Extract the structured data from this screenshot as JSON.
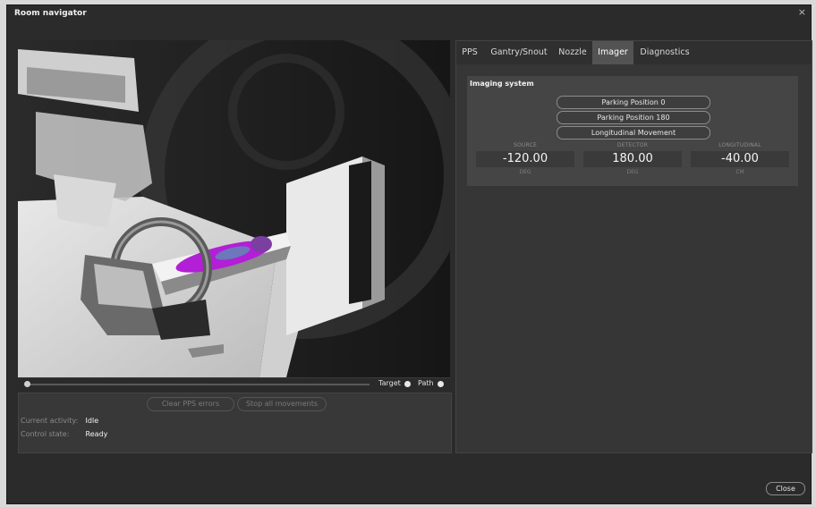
{
  "window": {
    "title": "Room navigator",
    "close_glyph": "×"
  },
  "viewport": {
    "scene": "treatment-room-3d-view",
    "toggles": [
      {
        "label": "Target"
      },
      {
        "label": "Path"
      }
    ]
  },
  "controls": {
    "clear_pps_errors": "Clear PPS errors",
    "stop_all_movements": "Stop all movements",
    "current_activity_label": "Current activity:",
    "current_activity_value": "Idle",
    "control_state_label": "Control state:",
    "control_state_value": "Ready"
  },
  "tabs": [
    {
      "label": "PPS",
      "active": false
    },
    {
      "label": "Gantry/Snout",
      "active": false
    },
    {
      "label": "Nozzle",
      "active": false
    },
    {
      "label": "Imager",
      "active": true
    },
    {
      "label": "Diagnostics",
      "active": false
    }
  ],
  "imaging": {
    "title": "Imaging system",
    "buttons": [
      "Parking Position 0",
      "Parking Position 180",
      "Longitudinal Movement"
    ],
    "values": [
      {
        "header": "SOURCE",
        "value": "-120.00",
        "unit": "DEG"
      },
      {
        "header": "DETECTOR",
        "value": "180.00",
        "unit": "DEG"
      },
      {
        "header": "LONGITUDINAL",
        "value": "-40.00",
        "unit": "CM"
      }
    ]
  },
  "footer": {
    "close_label": "Close"
  },
  "colors": {
    "background": "#2b2b2b",
    "panel": "#363636",
    "active_tab": "#535353",
    "patient_highlight": "#b21fd6"
  }
}
